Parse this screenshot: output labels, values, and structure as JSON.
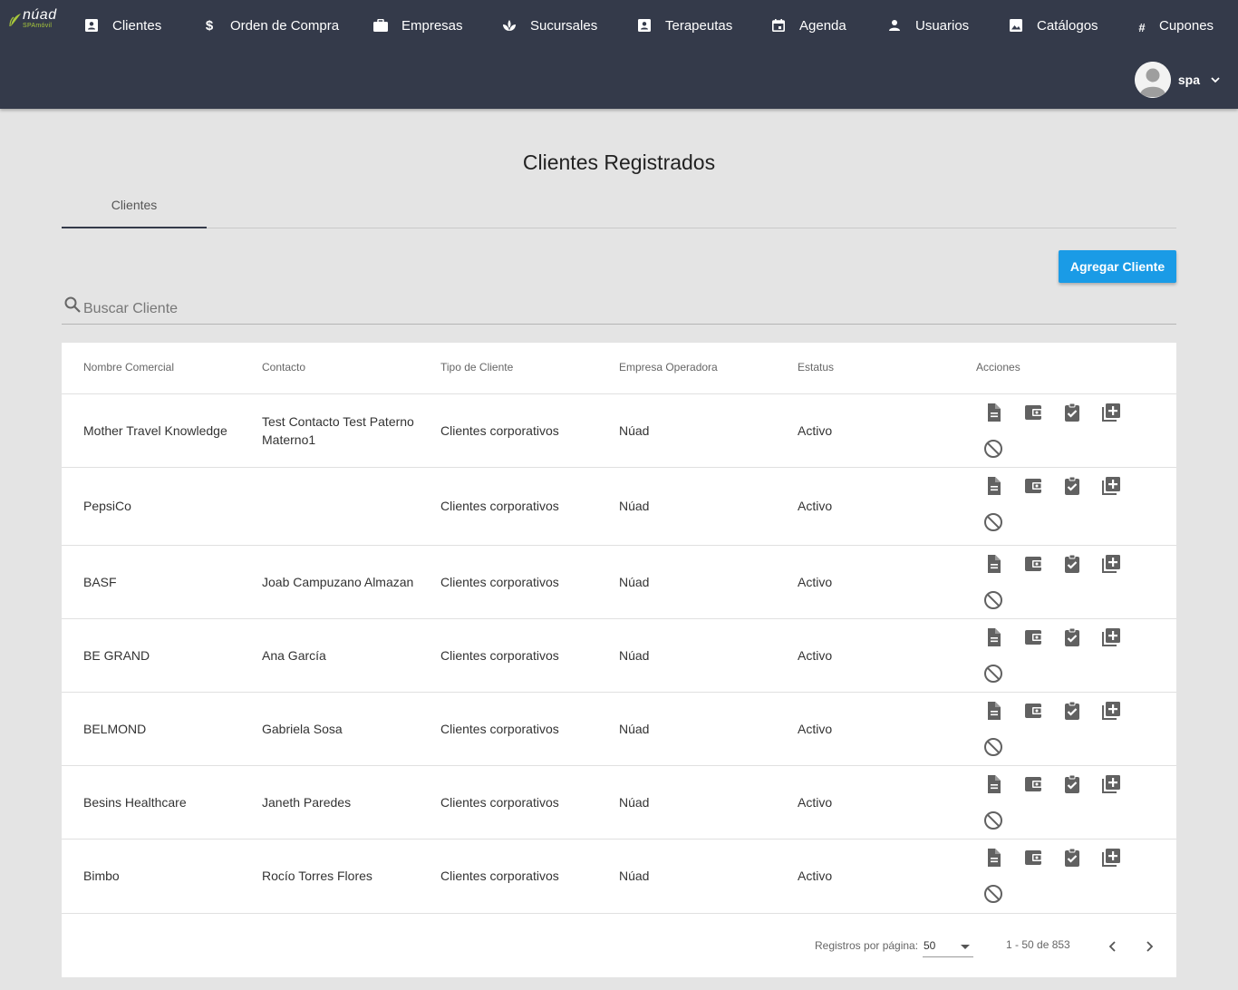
{
  "logo": {
    "brand": "núad",
    "sub": "SPAmóvil"
  },
  "nav": [
    {
      "label": "Clientes",
      "icon": "contact-card-icon"
    },
    {
      "label": "Orden de Compra",
      "icon": "dollar-icon"
    },
    {
      "label": "Empresas",
      "icon": "briefcase-icon"
    },
    {
      "label": "Sucursales",
      "icon": "spa-icon"
    },
    {
      "label": "Terapeutas",
      "icon": "contact-card-icon"
    },
    {
      "label": "Agenda",
      "icon": "calendar-icon"
    },
    {
      "label": "Usuarios",
      "icon": "person-icon"
    },
    {
      "label": "Catálogos",
      "icon": "image-icon"
    },
    {
      "label": "Cupones",
      "icon": "hash-icon"
    }
  ],
  "user": {
    "name": "spa"
  },
  "page": {
    "title": "Clientes Registrados"
  },
  "tabs": [
    {
      "label": "Clientes"
    }
  ],
  "toolbar": {
    "add_label": "Agregar Cliente"
  },
  "search": {
    "placeholder": "Buscar Cliente",
    "value": ""
  },
  "table": {
    "headers": [
      "Nombre Comercial",
      "Contacto",
      "Tipo de Cliente",
      "Empresa Operadora",
      "Estatus",
      "Acciones"
    ],
    "rows": [
      {
        "name": "Mother Travel Knowledge",
        "contact": "Test Contacto Test Paterno Materno1",
        "type": "Clientes corporativos",
        "company": "Núad",
        "status": "Activo"
      },
      {
        "name": "PepsiCo",
        "contact": "",
        "type": "Clientes corporativos",
        "company": "Núad",
        "status": "Activo"
      },
      {
        "name": "BASF",
        "contact": "Joab Campuzano Almazan",
        "type": "Clientes corporativos",
        "company": "Núad",
        "status": "Activo"
      },
      {
        "name": "BE GRAND",
        "contact": "Ana García",
        "type": "Clientes corporativos",
        "company": "Núad",
        "status": "Activo"
      },
      {
        "name": "BELMOND",
        "contact": "Gabriela Sosa",
        "type": "Clientes corporativos",
        "company": "Núad",
        "status": "Activo"
      },
      {
        "name": "Besins Healthcare",
        "contact": "Janeth Paredes",
        "type": "Clientes corporativos",
        "company": "Núad",
        "status": "Activo"
      },
      {
        "name": "Bimbo",
        "contact": "Rocío Torres Flores",
        "type": "Clientes corporativos",
        "company": "Núad",
        "status": "Activo"
      }
    ],
    "row_actions": [
      "document-icon",
      "wallet-icon",
      "clipboard-check-icon",
      "library-add-icon",
      "block-icon"
    ]
  },
  "pagination": {
    "rows_label": "Registros por página:",
    "rows_value": "50",
    "range": "1 - 50 de 853"
  },
  "colors": {
    "topbar": "#343a4a",
    "accent": "#1a9be6",
    "background": "#e4e4e4",
    "icon": "#616161"
  }
}
